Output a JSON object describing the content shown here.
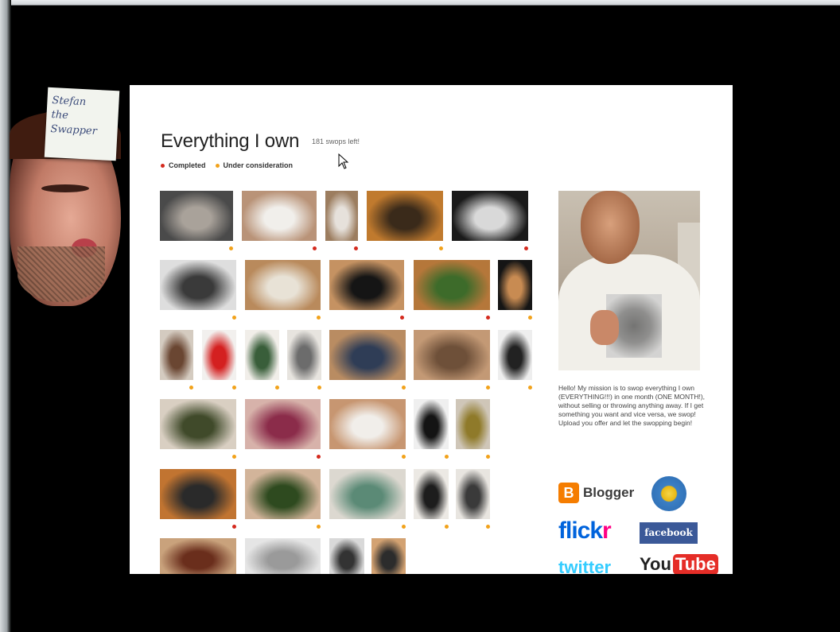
{
  "sticky_note": {
    "line1": "Stefan",
    "line2": "the",
    "line3": "Swapper"
  },
  "page": {
    "title": "Everything I own",
    "swaps_left": "181 swops left!",
    "legend": {
      "completed": "Completed",
      "under_consideration": "Under consideration"
    },
    "colors": {
      "completed": "#d42a1e",
      "under_consideration": "#f2a21b"
    }
  },
  "sidebar": {
    "bio": "Hello! My mission is to swop everything I own (EVERYTHING!!!) in one month (ONE MONTH!), without selling or throwing anything away. If I get something you want and vice versa, we swop! Upload you offer and let the swopping begin!",
    "logos": {
      "blogger": "Blogger",
      "flickr_a": "flick",
      "flickr_b": "r",
      "facebook": "facebook",
      "twitter": "twitter",
      "youtube_a": "You",
      "youtube_b": "Tube"
    }
  },
  "grid": {
    "items": [
      {
        "name": "apartment-photo",
        "status": "under_consideration",
        "tone": [
          "#4a4a4a",
          "#a9a29a"
        ]
      },
      {
        "name": "white-shirt-photo",
        "status": "completed",
        "tone": [
          "#b99378",
          "#f1efeb"
        ]
      },
      {
        "name": "cables-photo",
        "status": "completed",
        "tone": [
          "#9c7d5f",
          "#e6e1db"
        ]
      },
      {
        "name": "bowl-photo",
        "status": "under_consideration",
        "tone": [
          "#c07a2e",
          "#3a2a1a"
        ]
      },
      {
        "name": "watch-photo",
        "status": "completed",
        "tone": [
          "#1a1a1a",
          "#d9d9d9"
        ]
      },
      {
        "name": "shelf-photo",
        "status": "under_consideration",
        "tone": [
          "#dedede",
          "#3a3a3a"
        ]
      },
      {
        "name": "chains-photo",
        "status": "under_consideration",
        "tone": [
          "#b98a5c",
          "#e8e2d6"
        ]
      },
      {
        "name": "umbrella-photo",
        "status": "completed",
        "tone": [
          "#c59262",
          "#151515"
        ]
      },
      {
        "name": "green-strap-photo",
        "status": "completed",
        "tone": [
          "#b5773a",
          "#3d6b2a"
        ]
      },
      {
        "name": "bottle-photo",
        "status": "under_consideration",
        "tone": [
          "#151515",
          "#c88b52"
        ]
      },
      {
        "name": "jacket-photo",
        "status": "under_consideration",
        "tone": [
          "#d4cbc0",
          "#6a4632"
        ]
      },
      {
        "name": "red-scarf-photo",
        "status": "under_consideration",
        "tone": [
          "#f2f0ee",
          "#d42020"
        ]
      },
      {
        "name": "green-pants-photo",
        "status": "under_consideration",
        "tone": [
          "#f1eee9",
          "#395e3a"
        ]
      },
      {
        "name": "grey-shirt-photo",
        "status": "under_consideration",
        "tone": [
          "#e7e4df",
          "#6c6c6c"
        ]
      },
      {
        "name": "jeans-photo",
        "status": "under_consideration",
        "tone": [
          "#b98c62",
          "#2f3d56"
        ]
      },
      {
        "name": "brown-pants-photo",
        "status": "under_consideration",
        "tone": [
          "#c39975",
          "#6e5039"
        ]
      },
      {
        "name": "coat-photo",
        "status": "under_consideration",
        "tone": [
          "#eeeeee",
          "#222222"
        ]
      },
      {
        "name": "green-trousers-photo",
        "status": "under_consideration",
        "tone": [
          "#d9cfc2",
          "#404a2a"
        ]
      },
      {
        "name": "purple-shirts-photo",
        "status": "completed",
        "tone": [
          "#d7b2aa",
          "#8b2c4a"
        ]
      },
      {
        "name": "gloves-photo",
        "status": "under_consideration",
        "tone": [
          "#c79671",
          "#f1eeea"
        ]
      },
      {
        "name": "black-top-photo",
        "status": "under_consideration",
        "tone": [
          "#efefef",
          "#141414"
        ]
      },
      {
        "name": "yellow-item-photo",
        "status": "under_consideration",
        "tone": [
          "#cfc6b8",
          "#8f7a2a"
        ]
      },
      {
        "name": "bike-lights-photo",
        "status": "completed",
        "tone": [
          "#c17431",
          "#2a2a2a"
        ]
      },
      {
        "name": "boots-photo",
        "status": "under_consideration",
        "tone": [
          "#d2b49a",
          "#2e4a1f"
        ]
      },
      {
        "name": "scarves-photo",
        "status": "under_consideration",
        "tone": [
          "#dcd8d0",
          "#5b8a76"
        ]
      },
      {
        "name": "stand-photo",
        "status": "under_consideration",
        "tone": [
          "#ece9e4",
          "#1d1d1d"
        ]
      },
      {
        "name": "mic-stand-photo",
        "status": "under_consideration",
        "tone": [
          "#e8e5e0",
          "#3a3a3a"
        ]
      },
      {
        "name": "shoes-photo",
        "status": "",
        "tone": [
          "#c9a27c",
          "#6a2e1c"
        ]
      },
      {
        "name": "glass-photo",
        "status": "",
        "tone": [
          "#e5e5e5",
          "#9a9a9a"
        ]
      },
      {
        "name": "poles-photo",
        "status": "",
        "tone": [
          "#d9d9d9",
          "#333333"
        ]
      },
      {
        "name": "bag-photo",
        "status": "",
        "tone": [
          "#d3a272",
          "#2c2c2c"
        ]
      }
    ]
  }
}
